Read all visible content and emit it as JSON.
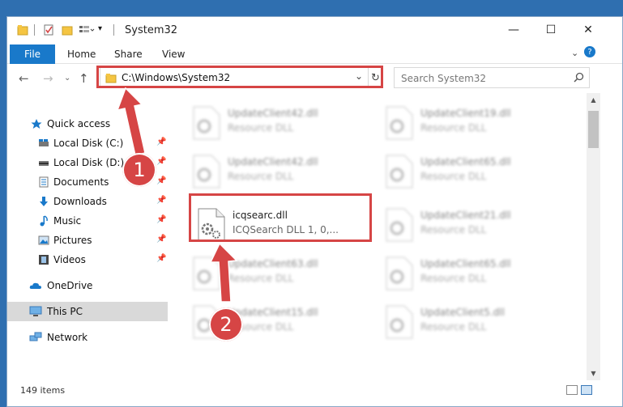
{
  "window": {
    "title": "System32",
    "controls": {
      "minimize": "—",
      "maximize": "☐",
      "close": "✕"
    }
  },
  "ribbon": {
    "tabs": [
      {
        "label": "File"
      },
      {
        "label": "Home"
      },
      {
        "label": "Share"
      },
      {
        "label": "View"
      }
    ],
    "expand": "⌄",
    "help": "?"
  },
  "address": {
    "path": "C:\\Windows\\System32",
    "dropdown": "⌄",
    "refresh": "↻"
  },
  "search": {
    "placeholder": "Search System32"
  },
  "navpane": {
    "items": [
      {
        "label": "Quick access",
        "icon": "star-icon"
      },
      {
        "label": "Local Disk (C:)",
        "icon": "drive-icon",
        "pinned": true
      },
      {
        "label": "Local Disk (D:)",
        "icon": "drive-icon",
        "pinned": true
      },
      {
        "label": "Documents",
        "icon": "documents-icon",
        "pinned": true
      },
      {
        "label": "Downloads",
        "icon": "downloads-icon",
        "pinned": true
      },
      {
        "label": "Music",
        "icon": "music-icon",
        "pinned": true
      },
      {
        "label": "Pictures",
        "icon": "pictures-icon",
        "pinned": true
      },
      {
        "label": "Videos",
        "icon": "videos-icon",
        "pinned": true
      },
      {
        "label": "OneDrive",
        "icon": "onedrive-icon"
      },
      {
        "label": "This PC",
        "icon": "pc-icon",
        "selected": true
      },
      {
        "label": "Network",
        "icon": "network-icon"
      }
    ]
  },
  "files": [
    {
      "name": "UpdateClient42.dll",
      "desc": "Resource DLL"
    },
    {
      "name": "UpdateClient19.dll",
      "desc": "Resource DLL"
    },
    {
      "name": "UpdateClient42.dll",
      "desc": "Resource DLL"
    },
    {
      "name": "UpdateClient65.dll",
      "desc": "Resource DLL"
    },
    {
      "name": "icqsearc.dll",
      "desc": "ICQSearch DLL 1, 0,..."
    },
    {
      "name": "UpdateClient21.dll",
      "desc": "Resource DLL"
    },
    {
      "name": "UpdateClient63.dll",
      "desc": "Resource DLL"
    },
    {
      "name": "UpdateClient65.dll",
      "desc": "Resource DLL"
    },
    {
      "name": "UpdateClient15.dll",
      "desc": "Resource DLL"
    },
    {
      "name": "UpdateClient5.dll",
      "desc": "Resource DLL"
    }
  ],
  "status": {
    "count": "149 items"
  },
  "annotations": {
    "step1": "1",
    "step2": "2"
  },
  "colors": {
    "accent": "#1979ca",
    "highlight": "#d64545",
    "selected": "#d9d9d9"
  }
}
